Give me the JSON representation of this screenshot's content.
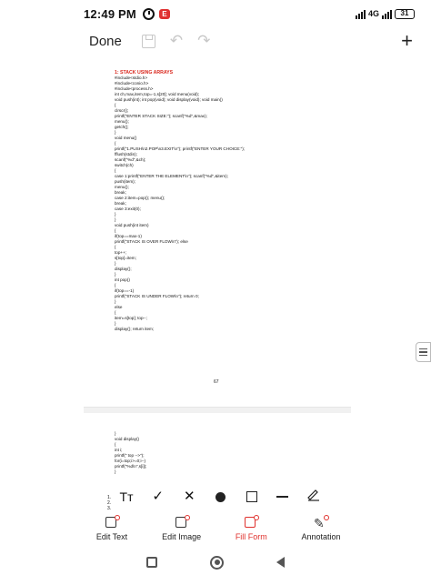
{
  "status_bar": {
    "time": "12:49 PM",
    "app_badge": "E",
    "network_label": "4G",
    "battery": "31"
  },
  "toolbar": {
    "done_label": "Done",
    "add_label": "+",
    "undo_glyph": "↶",
    "redo_glyph": "↷"
  },
  "document": {
    "page1_title": "1: STACK USING ARRAYS",
    "page1_code": "#include<stdio.h>\n#include<conio.h>\n#include<process.h>\nint ch,max,item,top=-1,s[20]; void menu(void);\nvoid push(int); int pop(void); void display(void); void main()\n{\nclrscr();\nprintf(\"ENTER STACK SIZE:\"); scanf(\"%d\",&max);\nmenu();\ngetch();\n}\nvoid menu()\n{\nprintf(\"1.PUSH\\n2.POP\\n3.EXIT\\n\"); printf(\"ENTER YOUR CHOICE:\");\nfflush(stdin);\nscanf(\"%d\",&ch);\nswitch(ch)\n{\ncase 1:printf(\"ENTER THE ELEMENT\\n\"); scanf(\"%d\",&item);\npush(item);\nmenu();\nbreak;\ncase 2:item=pop(); menu();\nbreak;\ncase 3:exit(0);\n}\n}\nvoid push(int item)\n{\nif(top==max-1)\nprintf(\"STACK IS OVER FLOW\\n\"); else\n{\ntop++;\ns[top]=item;\n}\ndisplay();\n}\nint pop()\n{\nif(top==-1)\nprintf(\"STACK IS UNDER FLOW\\n\"); return 0;\n}\nelse\n{\nitem=s[top]; top--;\n}\ndisplay(); return item;",
    "page1_number": "67",
    "page2_code": "}\nvoid display()\n{\nint i;\nprintf(\" top -->\");\nfor(i=top;i>=0;i--)\nprintf(\"%d\\n\",s[i]);\n}",
    "page2_edge": "1.\n2.\n3."
  },
  "markup_toolbar": {
    "text_tool": "Tт",
    "check_tool": "✓",
    "cross_tool": "✕"
  },
  "bottom_tabs": [
    {
      "label": "Edit Text"
    },
    {
      "label": "Edit Image"
    },
    {
      "label": "Fill Form"
    },
    {
      "label": "Annotation"
    }
  ],
  "colors": {
    "accent": "#e0312d",
    "title_red": "#d9261c"
  },
  "icons": [
    "alarm-icon",
    "save-icon",
    "undo-icon",
    "redo-icon",
    "add-icon",
    "menu-icon",
    "text-tool-icon",
    "check-icon",
    "cross-icon",
    "dot-icon",
    "square-icon",
    "line-icon",
    "signature-icon"
  ]
}
